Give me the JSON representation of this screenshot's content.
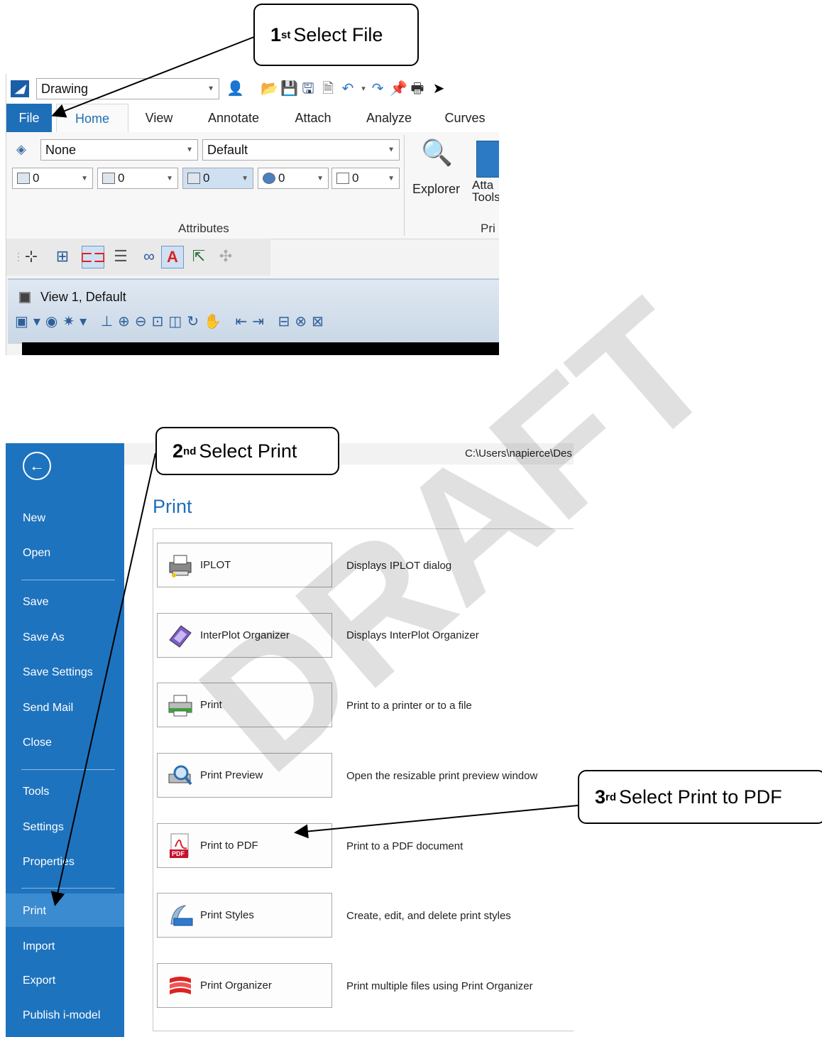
{
  "callouts": {
    "step1": {
      "num": "1",
      "suffix": "st",
      "text": "Select File"
    },
    "step2": {
      "num": "2",
      "suffix": "nd",
      "text": "Select Print"
    },
    "step3": {
      "num": "3",
      "suffix": "rd",
      "text": "Select Print to PDF"
    }
  },
  "watermark": "DRAFT",
  "ribbon": {
    "workflow": "Drawing",
    "tabs": [
      "File",
      "Home",
      "View",
      "Annotate",
      "Attach",
      "Analyze",
      "Curves"
    ],
    "level_combo": "None",
    "style_combo": "Default",
    "attribute_values": [
      "0",
      "0",
      "0",
      "0",
      "0"
    ],
    "attributes_label": "Attributes",
    "explorer_label": "Explorer",
    "attach_tools_label_1": "Atta",
    "attach_tools_label_2": "Tools",
    "primary_label": "Pri",
    "view_title": "View 1, Default"
  },
  "backstage": {
    "path": "C:\\Users\\napierce\\Des",
    "title": "Print",
    "sidebar": [
      "New",
      "Open",
      "Save",
      "Save As",
      "Save Settings",
      "Send Mail",
      "Close",
      "Tools",
      "Settings",
      "Properties",
      "Print",
      "Import",
      "Export",
      "Publish i-model"
    ],
    "commands": [
      {
        "label": "IPLOT",
        "desc": "Displays IPLOT dialog",
        "icon": "printer-plot-icon"
      },
      {
        "label": "InterPlot Organizer",
        "desc": "Displays InterPlot Organizer",
        "icon": "interplot-organizer-icon"
      },
      {
        "label": "Print",
        "desc": "Print to a printer or to a file",
        "icon": "printer-icon"
      },
      {
        "label": "Print Preview",
        "desc": "Open the resizable print preview window",
        "icon": "print-preview-icon"
      },
      {
        "label": "Print to PDF",
        "desc": "Print to a PDF document",
        "icon": "pdf-icon"
      },
      {
        "label": "Print Styles",
        "desc": "Create, edit, and delete print styles",
        "icon": "print-styles-icon"
      },
      {
        "label": "Print Organizer",
        "desc": "Print multiple files using Print Organizer",
        "icon": "print-organizer-icon"
      }
    ],
    "pdf_badge": "PDF"
  },
  "colors": {
    "file_tab": "#1e6fb8",
    "sidebar": "#1e73be",
    "sidebar_active": "#3b8bd0",
    "title": "#1e6fb8"
  }
}
